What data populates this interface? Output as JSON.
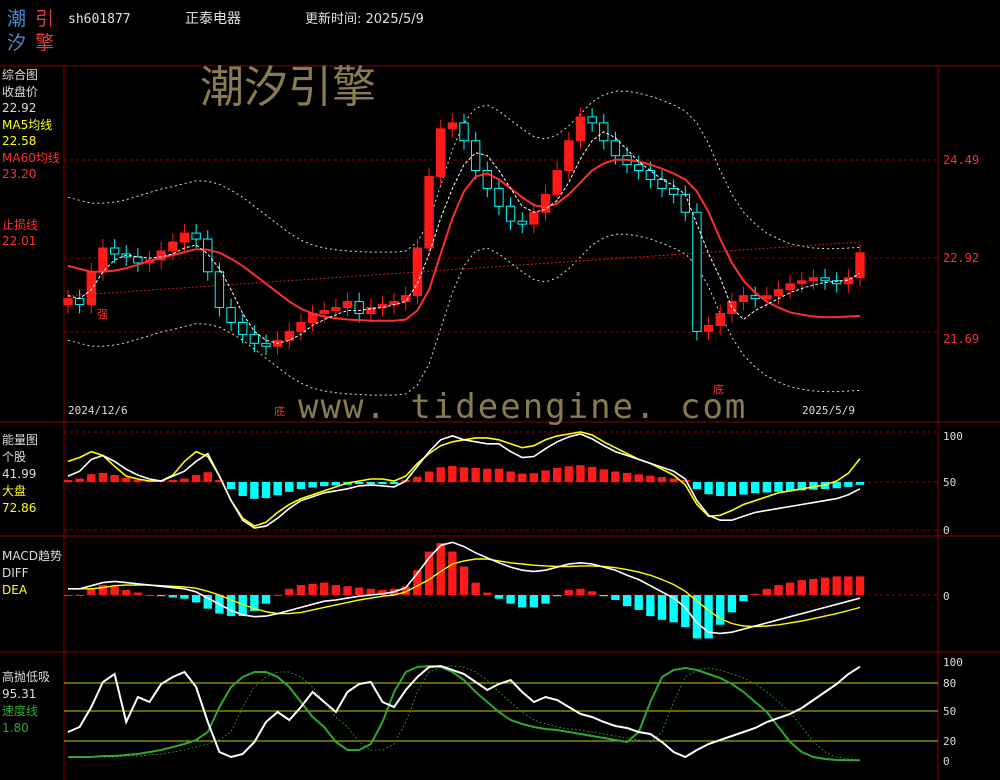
{
  "logo": {
    "chars": [
      "潮",
      "引",
      "汐",
      "擎"
    ]
  },
  "header": {
    "code": "sh601877",
    "name": "正泰电器",
    "update_label": "更新时间: 2025/5/9"
  },
  "watermarks": {
    "cn": "潮汐引擎",
    "url": "www. tideengine. com"
  },
  "colors": {
    "up": "#ff1a1a",
    "down": "#00ffff",
    "ma5": "#ffff00",
    "ma60": "#ff2e2e",
    "grid": "#8a0000",
    "diff": "#ffffff",
    "dea": "#ffff00",
    "speed": "#2ea82e"
  },
  "main_panel": {
    "title": "综合图",
    "labels": [
      {
        "key": "收盘价",
        "value": "22.92"
      },
      {
        "key": "MA5均线",
        "value": "22.58"
      },
      {
        "key": "MA60均线",
        "value": "23.20"
      },
      {
        "key": "止损线",
        "value": "22.01"
      }
    ],
    "price_axis": [
      "24.49",
      "22.92",
      "21.69"
    ],
    "date_start": "2024/12/6",
    "date_end": "2025/5/9",
    "marker_qiang": "强",
    "marker_di1": "底",
    "marker_di2": "底"
  },
  "energy_panel": {
    "title": "能量图",
    "label1": "个股",
    "value1": "41.99",
    "label2": "大盘",
    "value2": "72.86",
    "axis": [
      "100",
      "50",
      "0"
    ]
  },
  "macd_panel": {
    "title": "MACD趋势",
    "label1": "DIFF",
    "label2": "DEA",
    "axis": [
      "0"
    ]
  },
  "osc_panel": {
    "title": "高抛低吸",
    "value1": "95.31",
    "label2": "速度线",
    "value2": "1.80",
    "axis": [
      "100",
      "80",
      "50",
      "20",
      "0"
    ]
  },
  "chart_data": [
    {
      "type": "candlestick",
      "title": "综合图",
      "x_range": [
        "2024/12/6",
        "2025/5/9"
      ],
      "ylabel_ticks": [
        24.49,
        22.92,
        21.69
      ],
      "close_last": 22.92,
      "series": [
        {
          "name": "收盘价",
          "values": [
            22.15,
            22.05,
            22.6,
            23.0,
            22.9,
            22.85,
            22.75,
            22.8,
            22.95,
            23.1,
            23.25,
            23.15,
            22.6,
            22.0,
            21.75,
            21.55,
            21.4,
            21.35,
            21.45,
            21.6,
            21.75,
            21.9,
            21.95,
            22.0,
            22.1,
            21.9,
            22.0,
            22.05,
            22.1,
            22.2,
            23.0,
            24.2,
            25.0,
            25.1,
            24.8,
            24.3,
            24.0,
            23.7,
            23.45,
            23.4,
            23.6,
            23.9,
            24.3,
            24.8,
            25.2,
            25.1,
            24.8,
            24.55,
            24.4,
            24.3,
            24.15,
            24.0,
            23.9,
            23.6,
            21.6,
            21.7,
            21.9,
            22.1,
            22.2,
            22.15,
            22.2,
            22.3,
            22.4,
            22.45,
            22.5,
            22.45,
            22.4,
            22.5,
            22.92
          ]
        },
        {
          "name": "MA5均线",
          "values": [
            22.2,
            22.15,
            22.3,
            22.6,
            22.8,
            22.88,
            22.85,
            22.83,
            22.85,
            22.9,
            23.0,
            23.05,
            22.9,
            22.65,
            22.3,
            21.9,
            21.6,
            21.45,
            21.4,
            21.45,
            21.55,
            21.7,
            21.8,
            21.88,
            21.95,
            21.95,
            21.98,
            22.0,
            22.05,
            22.1,
            22.4,
            22.9,
            23.5,
            24.0,
            24.4,
            24.6,
            24.55,
            24.3,
            24.0,
            23.7,
            23.6,
            23.65,
            23.8,
            24.1,
            24.5,
            24.8,
            24.95,
            24.85,
            24.65,
            24.45,
            24.3,
            24.15,
            24.05,
            23.9,
            23.4,
            22.9,
            22.5,
            22.0,
            21.8,
            21.95,
            22.05,
            22.15,
            22.25,
            22.32,
            22.38,
            22.42,
            22.44,
            22.46,
            22.58
          ]
        },
        {
          "name": "MA60均线",
          "values": [
            22.7,
            22.65,
            22.6,
            22.6,
            22.62,
            22.66,
            22.72,
            22.78,
            22.84,
            22.88,
            22.93,
            22.98,
            22.97,
            22.92,
            22.82,
            22.7,
            22.55,
            22.4,
            22.25,
            22.1,
            21.98,
            21.9,
            21.85,
            21.82,
            21.8,
            21.79,
            21.78,
            21.78,
            21.78,
            21.8,
            21.95,
            22.3,
            22.9,
            23.5,
            23.95,
            24.2,
            24.25,
            24.15,
            24.0,
            23.85,
            23.72,
            23.68,
            23.75,
            23.9,
            24.1,
            24.3,
            24.42,
            24.48,
            24.48,
            24.45,
            24.4,
            24.33,
            24.25,
            24.15,
            23.95,
            23.6,
            23.15,
            22.75,
            22.45,
            22.25,
            22.1,
            22.0,
            21.92,
            21.88,
            21.85,
            21.84,
            21.84,
            21.85,
            21.86
          ]
        },
        {
          "name": "止损线",
          "values": [
            22.01
          ]
        }
      ]
    },
    {
      "type": "line",
      "title": "能量图",
      "ylim": [
        0,
        100
      ],
      "series": [
        {
          "name": "个股",
          "values": [
            55,
            60,
            72,
            76,
            70,
            62,
            56,
            52,
            50,
            55,
            60,
            70,
            78,
            55,
            30,
            10,
            2,
            4,
            12,
            22,
            30,
            34,
            38,
            40,
            42,
            45,
            46,
            45,
            44,
            50,
            65,
            80,
            92,
            96,
            92,
            90,
            88,
            88,
            80,
            74,
            75,
            83,
            90,
            95,
            98,
            93,
            86,
            80,
            76,
            72,
            68,
            64,
            60,
            52,
            30,
            15,
            10,
            10,
            14,
            18,
            20,
            22,
            24,
            26,
            28,
            30,
            32,
            36,
            41.99
          ]
        },
        {
          "name": "大盘",
          "values": [
            70,
            74,
            80,
            76,
            65,
            55,
            52,
            50,
            50,
            56,
            70,
            80,
            75,
            55,
            30,
            12,
            4,
            8,
            18,
            26,
            32,
            36,
            40,
            44,
            48,
            50,
            52,
            52,
            50,
            55,
            68,
            78,
            86,
            90,
            92,
            94,
            94,
            92,
            88,
            84,
            86,
            92,
            96,
            98,
            100,
            97,
            90,
            84,
            78,
            72,
            68,
            62,
            56,
            46,
            26,
            14,
            15,
            20,
            26,
            30,
            34,
            38,
            40,
            42,
            44,
            46,
            50,
            58,
            72.86
          ]
        }
      ]
    },
    {
      "type": "line",
      "title": "MACD趋势",
      "series": [
        {
          "name": "DIFF",
          "values": [
            0.1,
            0.1,
            0.15,
            0.2,
            0.22,
            0.2,
            0.18,
            0.16,
            0.14,
            0.12,
            0.1,
            0.05,
            -0.05,
            -0.15,
            -0.25,
            -0.32,
            -0.35,
            -0.34,
            -0.3,
            -0.25,
            -0.2,
            -0.15,
            -0.1,
            -0.08,
            -0.05,
            -0.02,
            0.0,
            0.02,
            0.05,
            0.12,
            0.35,
            0.6,
            0.8,
            0.85,
            0.78,
            0.68,
            0.6,
            0.52,
            0.45,
            0.4,
            0.38,
            0.4,
            0.45,
            0.5,
            0.52,
            0.5,
            0.45,
            0.4,
            0.32,
            0.25,
            0.15,
            0.05,
            -0.05,
            -0.2,
            -0.45,
            -0.6,
            -0.62,
            -0.6,
            -0.55,
            -0.5,
            -0.45,
            -0.4,
            -0.35,
            -0.3,
            -0.25,
            -0.2,
            -0.15,
            -0.1,
            -0.05
          ]
        },
        {
          "name": "DEA",
          "values": [
            0.1,
            0.1,
            0.1,
            0.12,
            0.15,
            0.16,
            0.16,
            0.16,
            0.15,
            0.14,
            0.13,
            0.11,
            0.06,
            0.0,
            -0.08,
            -0.15,
            -0.22,
            -0.27,
            -0.3,
            -0.3,
            -0.28,
            -0.24,
            -0.2,
            -0.16,
            -0.12,
            -0.08,
            -0.05,
            -0.02,
            0.0,
            0.05,
            0.15,
            0.25,
            0.38,
            0.5,
            0.55,
            0.58,
            0.58,
            0.55,
            0.52,
            0.5,
            0.48,
            0.47,
            0.46,
            0.46,
            0.47,
            0.47,
            0.46,
            0.44,
            0.41,
            0.37,
            0.32,
            0.25,
            0.17,
            0.06,
            -0.1,
            -0.25,
            -0.38,
            -0.46,
            -0.5,
            -0.51,
            -0.5,
            -0.48,
            -0.45,
            -0.42,
            -0.38,
            -0.34,
            -0.3,
            -0.25,
            -0.2
          ]
        }
      ]
    },
    {
      "type": "line",
      "title": "高抛低吸",
      "ylim": [
        0,
        100
      ],
      "series": [
        {
          "name": "高抛低吸",
          "values": [
            30,
            35,
            55,
            80,
            88,
            40,
            65,
            60,
            78,
            85,
            90,
            75,
            40,
            10,
            5,
            8,
            20,
            40,
            50,
            42,
            55,
            70,
            60,
            50,
            70,
            78,
            80,
            60,
            55,
            72,
            85,
            95,
            96,
            92,
            88,
            80,
            72,
            78,
            82,
            70,
            60,
            65,
            62,
            55,
            48,
            45,
            40,
            36,
            34,
            30,
            28,
            20,
            10,
            5,
            12,
            18,
            22,
            26,
            30,
            34,
            40,
            44,
            48,
            54,
            62,
            70,
            78,
            88,
            95.31
          ]
        },
        {
          "name": "速度线",
          "values": [
            5,
            5,
            5,
            6,
            6,
            7,
            8,
            10,
            12,
            15,
            18,
            22,
            30,
            55,
            75,
            85,
            90,
            90,
            85,
            75,
            60,
            45,
            35,
            20,
            12,
            12,
            18,
            40,
            70,
            90,
            95,
            96,
            95,
            90,
            82,
            70,
            60,
            50,
            42,
            38,
            35,
            33,
            32,
            30,
            28,
            26,
            24,
            22,
            20,
            30,
            60,
            85,
            92,
            94,
            92,
            88,
            84,
            78,
            70,
            60,
            50,
            35,
            20,
            10,
            5,
            3,
            2,
            1.8,
            1.8
          ]
        }
      ]
    }
  ]
}
